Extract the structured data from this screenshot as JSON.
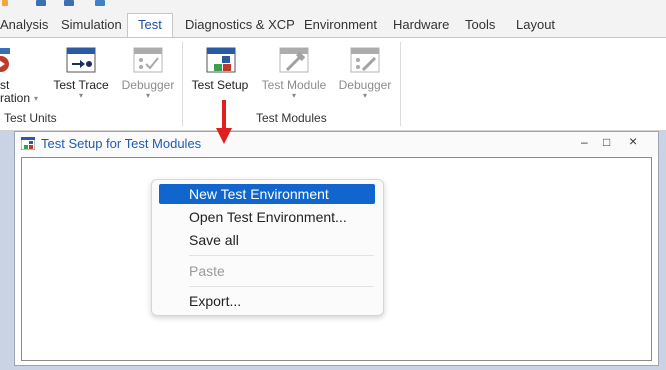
{
  "ribbon_tabs": [
    "Analysis",
    "Simulation",
    "Test",
    "Diagnostics & XCP",
    "Environment",
    "Hardware",
    "Tools",
    "Layout"
  ],
  "active_tab": "Test",
  "ribbon": {
    "partial_button": {
      "line1": "st",
      "line2": "ration"
    },
    "test_trace": "Test Trace",
    "debugger1": "Debugger",
    "test_setup": "Test Setup",
    "test_module": "Test Module",
    "debugger2": "Debugger",
    "group_test_units": "Test Units",
    "group_test_modules": "Test Modules"
  },
  "window": {
    "title": "Test Setup for Test Modules",
    "minimize_glyph": "–",
    "maximize_glyph": "□",
    "close_glyph": "×"
  },
  "context_menu": {
    "items": [
      {
        "label": "New Test Environment",
        "state": "highlighted"
      },
      {
        "label": "Open Test Environment...",
        "state": "normal"
      },
      {
        "label": "Save all",
        "state": "normal"
      },
      {
        "label": "Paste",
        "state": "disabled"
      },
      {
        "label": "Export...",
        "state": "normal"
      }
    ]
  },
  "colors": {
    "accent": "#1066cc",
    "active_tab_text": "#1d4fa0",
    "window_title": "#1e5cb3",
    "annotation_arrow": "#e02020"
  }
}
